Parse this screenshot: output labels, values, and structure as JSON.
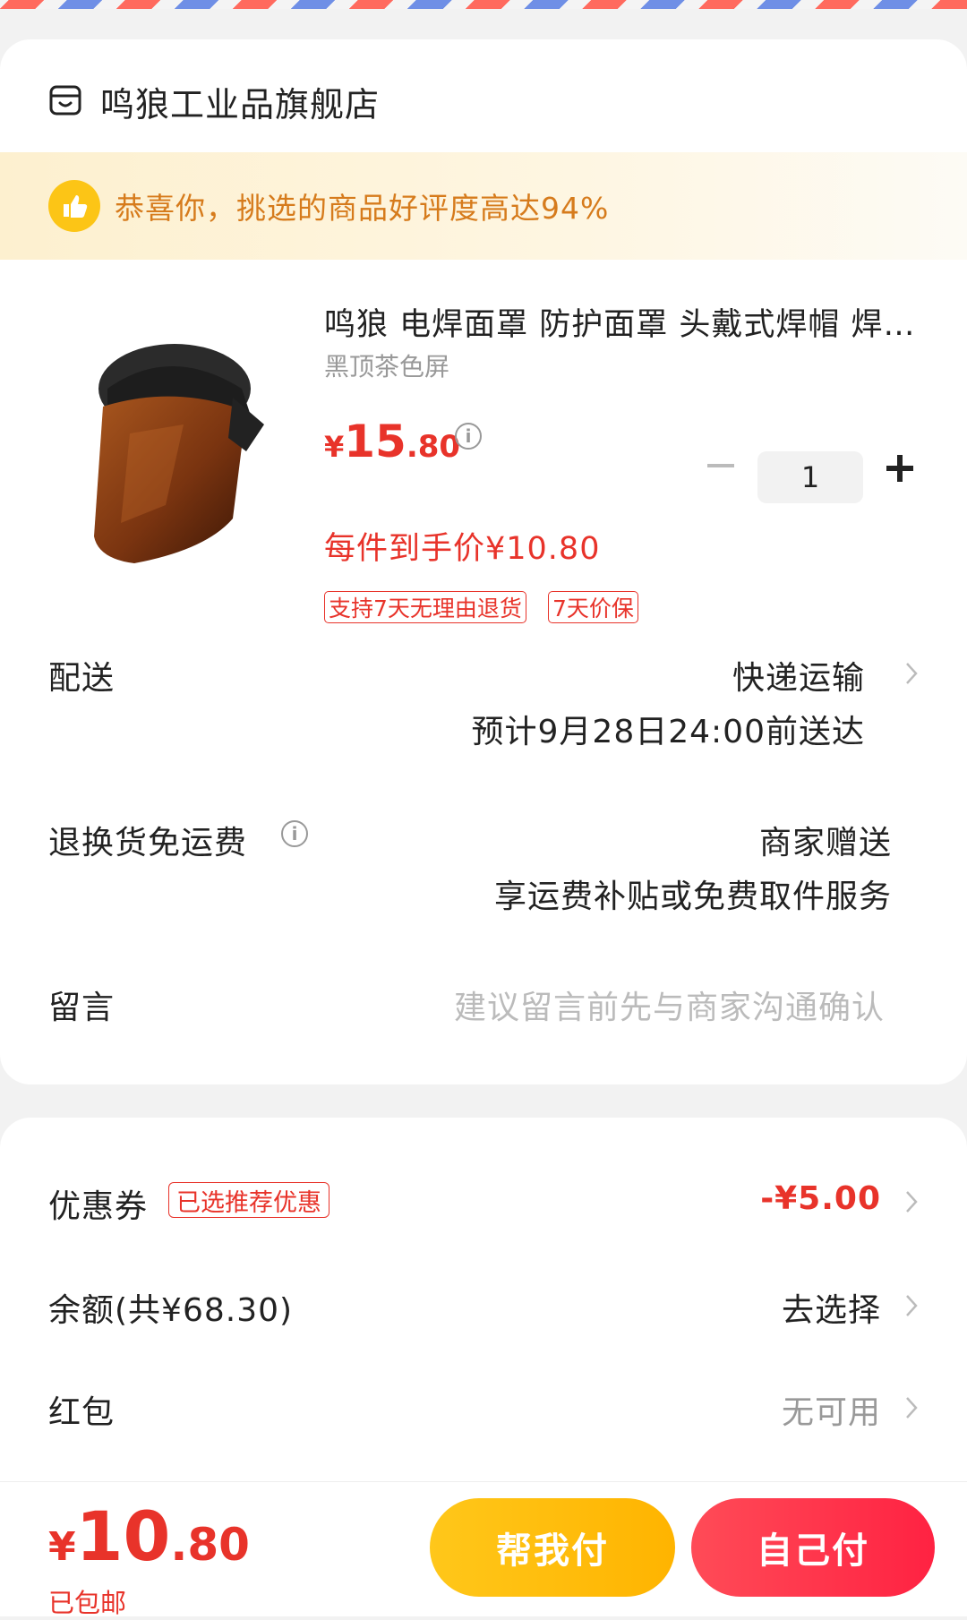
{
  "store": {
    "name": "鸣狼工业品旗舰店",
    "icon": "store-icon"
  },
  "praise": {
    "text": "恭喜你，挑选的商品好评度高达94%",
    "icon": "thumbs-up-icon"
  },
  "product": {
    "title": "鸣狼 电焊面罩 防护面罩 头戴式焊帽 焊工专用",
    "variant": "黑顶茶色屏",
    "price_symbol": "¥",
    "price_int": "15",
    "price_dec": ".80",
    "hand_price": "每件到手价¥10.80",
    "tags": [
      "支持7天无理由退货",
      "7天价保"
    ],
    "quantity": "1"
  },
  "delivery": {
    "label": "配送",
    "method": "快递运输",
    "eta": "预计9月28日24:00前送达"
  },
  "return_shipping": {
    "label": "退换货免运费",
    "value": "商家赠送",
    "detail": "享运费补贴或免费取件服务"
  },
  "message": {
    "label": "留言",
    "placeholder": "建议留言前先与商家沟通确认"
  },
  "coupon": {
    "label": "优惠券",
    "badge": "已选推荐优惠",
    "value": "-¥5.00"
  },
  "balance": {
    "label": "余额(共¥68.30)",
    "value": "去选择"
  },
  "red_packet": {
    "label": "红包",
    "value": "无可用"
  },
  "footer": {
    "total_symbol": "¥",
    "total_int": "10",
    "total_dec": ".80",
    "shipping_note": "已包邮",
    "help_pay": "帮我付",
    "self_pay": "自己付"
  },
  "colors": {
    "accent_red": "#e8332a",
    "help_button": "#ffc71a",
    "self_button": "#ff2242",
    "praise_text": "#d67b1c"
  }
}
